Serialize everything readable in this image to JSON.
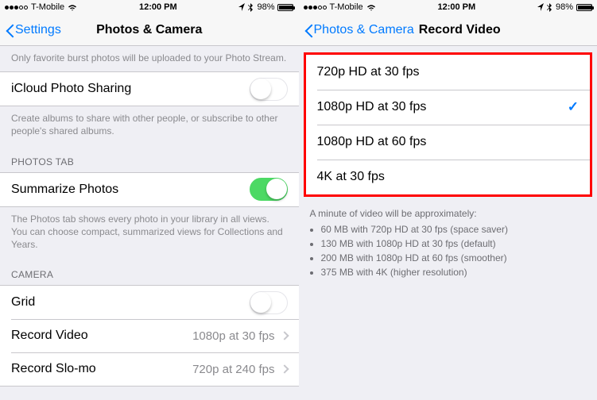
{
  "left": {
    "statusbar": {
      "carrier": "T-Mobile",
      "time": "12:00 PM",
      "battery_pct": "98%"
    },
    "nav": {
      "back": "Settings",
      "title": "Photos & Camera"
    },
    "burst_footer": "Only favorite burst photos will be uploaded to your Photo Stream.",
    "icloud_sharing": {
      "label": "iCloud Photo Sharing",
      "on": false
    },
    "icloud_footer": "Create albums to share with other people, or subscribe to other people's shared albums.",
    "photos_tab_header": "PHOTOS TAB",
    "summarize": {
      "label": "Summarize Photos",
      "on": true
    },
    "summarize_footer": "The Photos tab shows every photo in your library in all views. You can choose compact, summarized views for Collections and Years.",
    "camera_header": "CAMERA",
    "grid": {
      "label": "Grid",
      "on": false
    },
    "record_video": {
      "label": "Record Video",
      "value": "1080p at 30 fps"
    },
    "record_slomo": {
      "label": "Record Slo-mo",
      "value": "720p at 240 fps"
    }
  },
  "right": {
    "statusbar": {
      "carrier": "T-Mobile",
      "time": "12:00 PM",
      "battery_pct": "98%"
    },
    "nav": {
      "back": "Photos & Camera",
      "title": "Record Video"
    },
    "options": [
      {
        "label": "720p HD at 30 fps",
        "selected": false
      },
      {
        "label": "1080p HD at 30 fps",
        "selected": true
      },
      {
        "label": "1080p HD at 60 fps",
        "selected": false
      },
      {
        "label": "4K at 30 fps",
        "selected": false
      }
    ],
    "footer_title": "A minute of video will be approximately:",
    "footer_items": [
      "60 MB with 720p HD at 30 fps (space saver)",
      "130 MB with 1080p HD at 30 fps (default)",
      "200 MB with 1080p HD at 60 fps (smoother)",
      "375 MB with 4K (higher resolution)"
    ]
  }
}
